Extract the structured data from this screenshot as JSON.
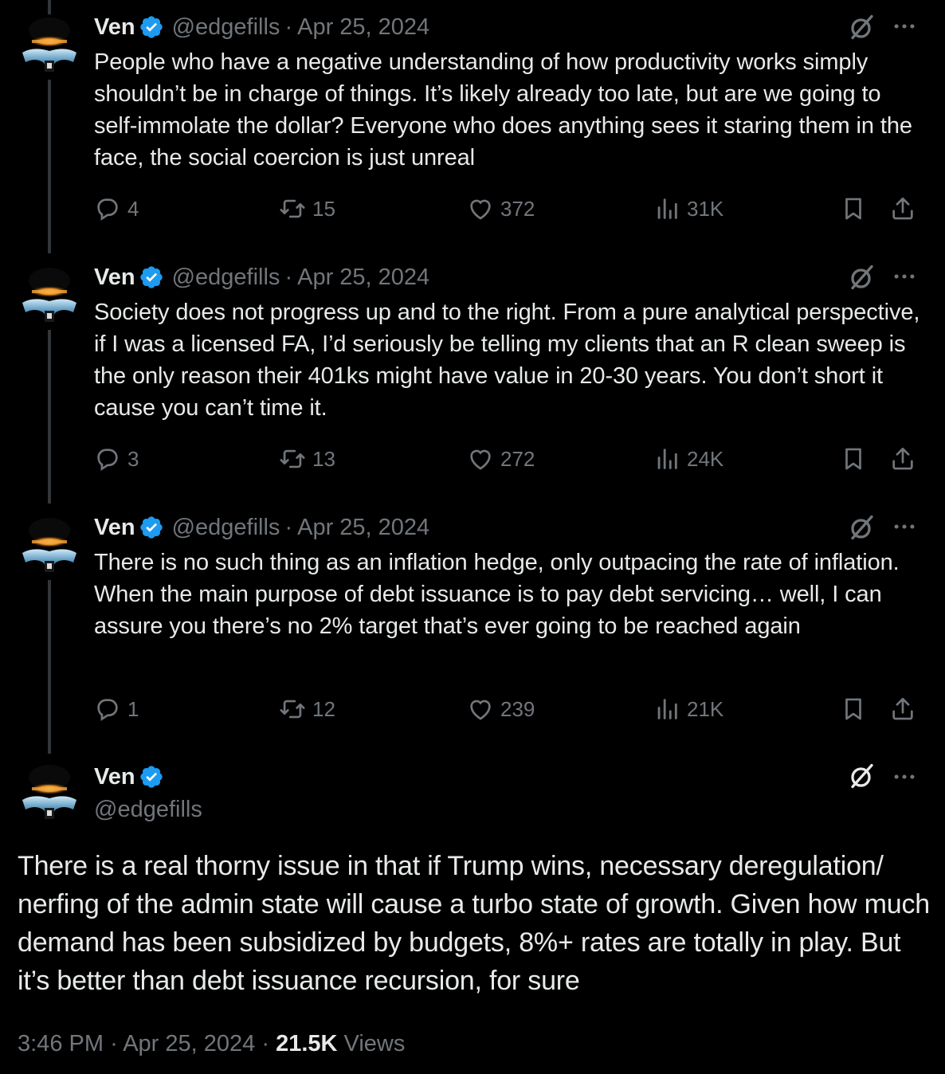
{
  "colors": {
    "background": "#000000",
    "text_primary": "#e7e9ea",
    "text_secondary": "#71767b",
    "verified_badge": "#1d9bf0",
    "thread_line": "#333639"
  },
  "icons": {
    "verified": "verified-badge-icon",
    "grok": "grok-icon",
    "more": "more-options-icon",
    "reply": "reply-icon",
    "retweet": "retweet-icon",
    "like": "heart-icon",
    "views": "views-chart-icon",
    "bookmark": "bookmark-icon",
    "share": "share-icon"
  },
  "thread": [
    {
      "name": "Ven",
      "handle": "@edgefills",
      "separator": "·",
      "date": "Apr 25, 2024",
      "text": "People who have a negative understanding of how productivity works simply shouldn’t be in charge of things. It’s likely already too late, but are we going to self-immolate the dollar? Everyone who does anything sees it staring them in the face, the social coercion is just unreal",
      "replies": "4",
      "reposts": "15",
      "likes": "372",
      "views": "31K"
    },
    {
      "name": "Ven",
      "handle": "@edgefills",
      "separator": "·",
      "date": "Apr 25, 2024",
      "text": "Society does not progress up and to the right. From a pure analytical perspective, if I was a licensed FA, I’d seriously be telling my clients that an R clean sweep is the only reason their 401ks might have value in 20-30 years. You don’t short it cause you can’t time it.",
      "replies": "3",
      "reposts": "13",
      "likes": "272",
      "views": "24K"
    },
    {
      "name": "Ven",
      "handle": "@edgefills",
      "separator": "·",
      "date": "Apr 25, 2024",
      "text": "There is no such thing as an inflation hedge, only outpacing the rate of inflation. When the main purpose of debt issuance is to pay debt servicing… well, I can assure you there’s no 2% target that’s ever going to be reached again",
      "replies": "1",
      "reposts": "12",
      "likes": "239",
      "views": "21K"
    }
  ],
  "main_tweet": {
    "name": "Ven",
    "handle": "@edgefills",
    "text": "There is a real thorny issue in that if Trump wins, necessary deregulation/ nerfing of the admin state will cause a turbo state of growth. Given how much demand has been subsidized by budgets, 8%+ rates are totally in play. But it’s better than debt issuance recursion, for sure",
    "time": "3:46 PM",
    "separator": "·",
    "date": "Apr 25, 2024",
    "views_count": "21.5K",
    "views_label": "Views"
  }
}
